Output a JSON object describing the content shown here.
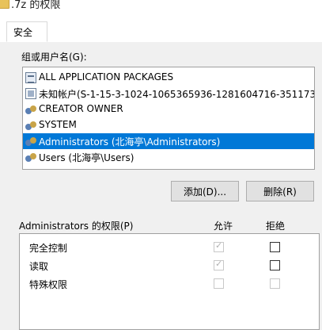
{
  "title": ".7z 的权限",
  "tabs": [
    {
      "label": "安全"
    }
  ],
  "users_label": "组或用户名(G):",
  "users": [
    {
      "name": "ALL APPLICATION PACKAGES",
      "icon": "package-icon",
      "selected": false
    },
    {
      "name": "未知帐户(S-1-15-3-1024-1065365936-1281604716-351173…",
      "icon": "unknown-account-icon",
      "selected": false
    },
    {
      "name": "CREATOR OWNER",
      "icon": "group-icon",
      "selected": false
    },
    {
      "name": "SYSTEM",
      "icon": "group-icon",
      "selected": false
    },
    {
      "name": "Administrators (北海亭\\Administrators)",
      "icon": "group-icon",
      "selected": true
    },
    {
      "name": "Users (北海亭\\Users)",
      "icon": "group-icon",
      "selected": false
    }
  ],
  "buttons": {
    "add": "添加(D)...",
    "remove": "删除(R)"
  },
  "permissions": {
    "title": "Administrators 的权限(P)",
    "allow_header": "允许",
    "deny_header": "拒绝",
    "rows": [
      {
        "label": "完全控制",
        "allow": true,
        "deny": false,
        "allow_disabled": true,
        "deny_disabled": false
      },
      {
        "label": "读取",
        "allow": true,
        "deny": false,
        "allow_disabled": true,
        "deny_disabled": false
      },
      {
        "label": "特殊权限",
        "allow": false,
        "deny": false,
        "allow_disabled": true,
        "deny_disabled": true
      }
    ]
  },
  "colors": {
    "selection": "#0078d7",
    "panel": "#f0f0f0"
  }
}
